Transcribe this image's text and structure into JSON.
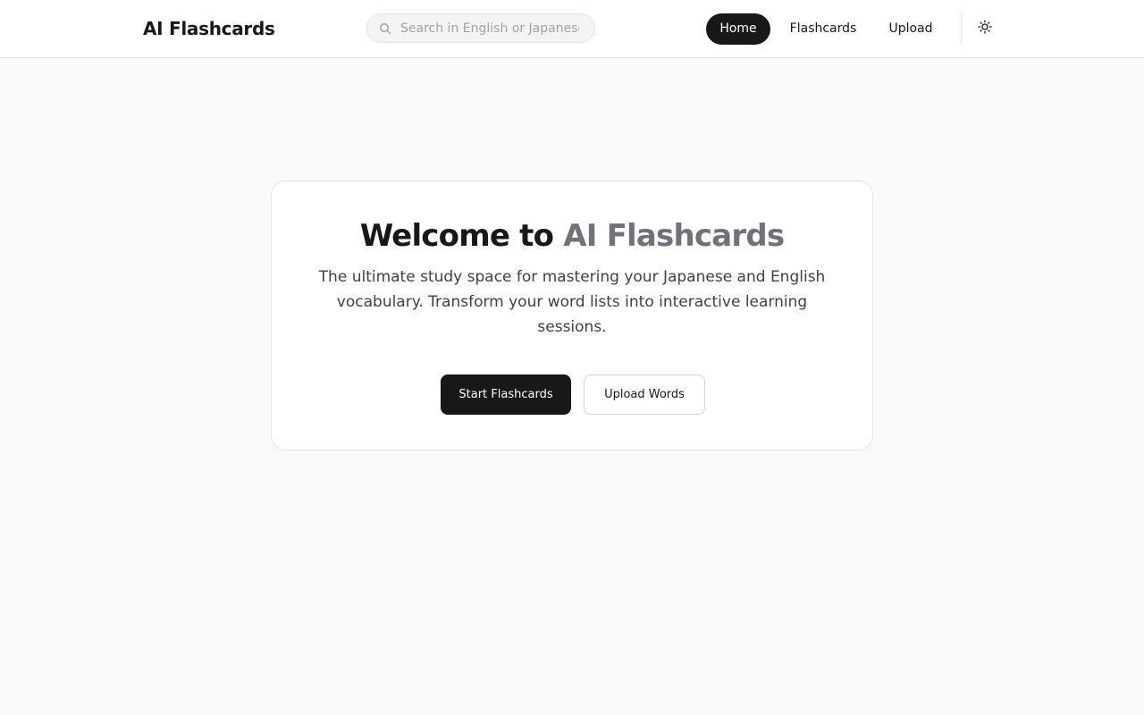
{
  "header": {
    "logo": "AI Flashcards",
    "search": {
      "placeholder": "Search in English or Japanese",
      "value": "",
      "icon": "search-icon"
    },
    "nav": [
      {
        "label": "Home",
        "active": true
      },
      {
        "label": "Flashcards",
        "active": false
      },
      {
        "label": "Upload",
        "active": false
      }
    ],
    "theme_toggle_icon": "sun-icon"
  },
  "hero": {
    "title_prefix": "Welcome to",
    "title_accent": "AI Flashcards",
    "subtitle": "The ultimate study space for mastering your Japanese and English vocabulary. Transform your word lists into interactive learning sessions.",
    "primary_button": "Start Flashcards",
    "secondary_button": "Upload Words"
  },
  "colors": {
    "background": "#fafafa",
    "surface": "#ffffff",
    "primary": "#18181b",
    "accent_text": "#71717a",
    "border": "#e4e4e7"
  }
}
